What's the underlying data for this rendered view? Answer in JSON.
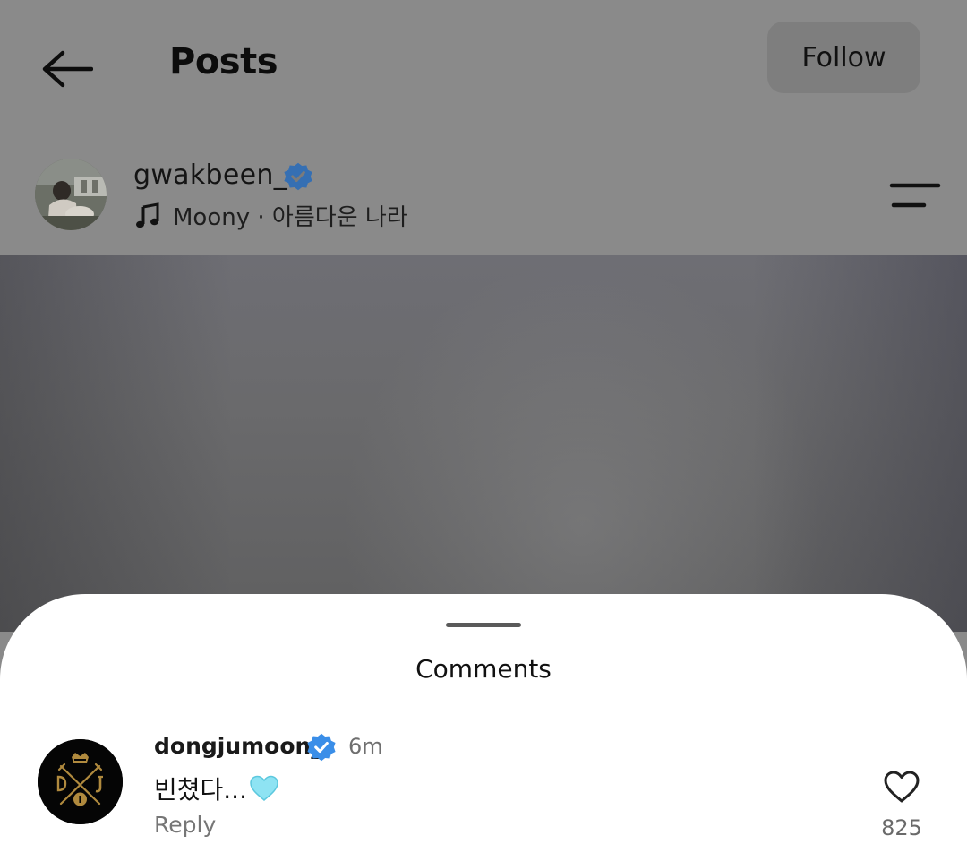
{
  "header": {
    "title": "Posts",
    "follow_label": "Follow"
  },
  "post": {
    "username": "gwakbeen_",
    "verified": true,
    "music": "Moony · 아름다운 나라"
  },
  "comments_sheet": {
    "title": "Comments",
    "comments": [
      {
        "username": "dongjumoon_",
        "verified": true,
        "time": "6m",
        "text": "빈쳤다...",
        "emoji": "light-blue-heart",
        "reply_label": "Reply",
        "like_count": "825"
      }
    ]
  },
  "colors": {
    "verified_blue": "#3a8ee8",
    "dim_overlay": "#8a8a8a",
    "sheet_background": "#ffffff"
  }
}
